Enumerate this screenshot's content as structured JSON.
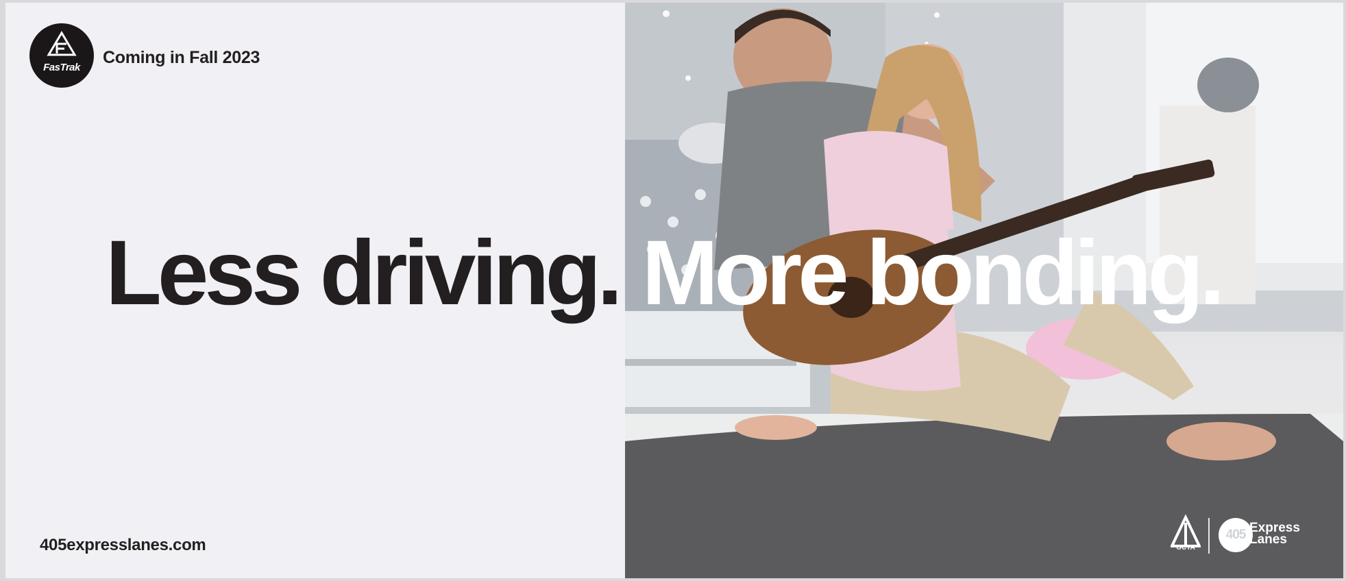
{
  "logo": {
    "brand": "FasTrak"
  },
  "tagline": "Coming in Fall 2023",
  "headline": {
    "part1": "Less driving.",
    "part2": "More bonding."
  },
  "url": "405expresslanes.com",
  "partner_logos": {
    "octa": "OCTA",
    "express_number": "405",
    "express_line1": "Express",
    "express_line2": "Lanes"
  },
  "colors": {
    "background": "#f1f0f4",
    "text_dark": "#231f20",
    "text_light": "#ffffff"
  }
}
